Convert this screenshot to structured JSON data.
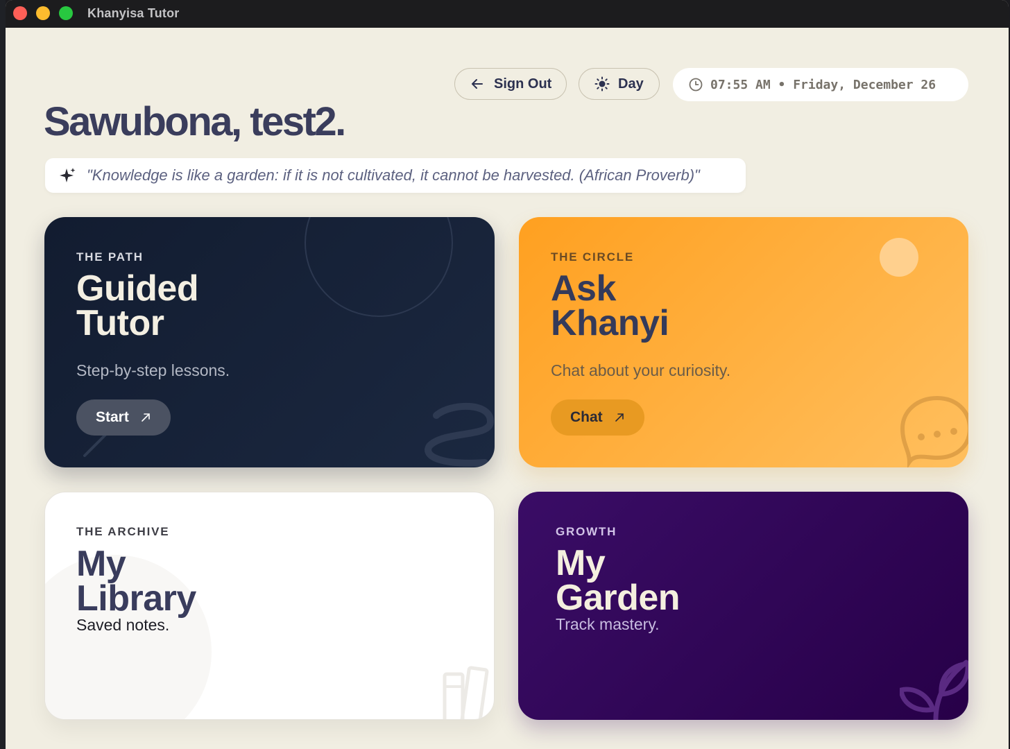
{
  "window": {
    "title": "Khanyisa Tutor"
  },
  "header": {
    "sign_out_label": "Sign Out",
    "theme_label": "Day",
    "clock_text": "07:55 AM • Friday, December 26"
  },
  "greeting": "Sawubona, test2.",
  "quote": "\"Knowledge is like a garden: if it is not cultivated, it cannot be harvested. (African Proverb)\"",
  "cards": [
    {
      "eyebrow": "THE PATH",
      "title_line1": "Guided",
      "title_line2": "Tutor",
      "subtitle": "Step-by-step lessons.",
      "button": "Start"
    },
    {
      "eyebrow": "THE CIRCLE",
      "title_line1": "Ask",
      "title_line2": "Khanyi",
      "subtitle": "Chat about your curiosity.",
      "button": "Chat"
    },
    {
      "eyebrow": "THE ARCHIVE",
      "title_line1": "My",
      "title_line2": "Library",
      "subtitle": "Saved notes."
    },
    {
      "eyebrow": "GROWTH",
      "title_line1": "My",
      "title_line2": "Garden",
      "subtitle": "Track mastery."
    }
  ],
  "icons": {
    "sign_out": "arrow-left-icon",
    "theme": "sun-icon",
    "clock": "clock-icon",
    "quote": "sparkle-icon",
    "card_button": "arrow-up-right-icon"
  },
  "colors": {
    "background": "#f1eee2",
    "path_card": "#121c30",
    "circle_card": "#ffa020",
    "archive_card": "#ffffff",
    "growth_card": "#3a0d66",
    "heading": "#3a3d5c"
  }
}
